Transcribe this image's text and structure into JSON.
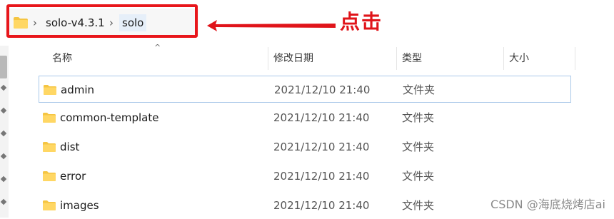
{
  "breadcrumb": {
    "items": [
      {
        "label": "solo-v4.3.1"
      },
      {
        "label": "solo"
      }
    ]
  },
  "annotation": {
    "text": "点击",
    "color": "#e0141a"
  },
  "columns": {
    "name": "名称",
    "modified": "修改日期",
    "type": "类型",
    "size": "大小"
  },
  "rows": [
    {
      "name": "admin",
      "modified": "2021/12/10 21:40",
      "type": "文件夹",
      "selected": true
    },
    {
      "name": "common-template",
      "modified": "2021/12/10 21:40",
      "type": "文件夹"
    },
    {
      "name": "dist",
      "modified": "2021/12/10 21:40",
      "type": "文件夹"
    },
    {
      "name": "error",
      "modified": "2021/12/10 21:40",
      "type": "文件夹"
    },
    {
      "name": "images",
      "modified": "2021/12/10 21:40",
      "type": "文件夹"
    }
  ],
  "watermark": "CSDN @海底烧烤店ai",
  "colors": {
    "folder": "#f5c542",
    "selection_border": "#a9c8e9",
    "highlight": "#e8161b"
  }
}
